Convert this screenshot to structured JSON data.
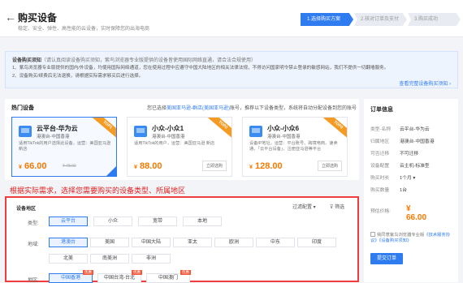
{
  "header": {
    "back_icon": "arrow-left-icon",
    "title": "购买设备",
    "subtitle": "稳定、安全、弹性、高性能的云设备，实时保障您的出海电商",
    "steps": [
      "1.选择购买方案",
      "2.核对订单及支付",
      "3.购买成功"
    ]
  },
  "notice": {
    "title": "设备购买须知",
    "title_note": "（请认真阅读设备购买须知，紫鸟浏览器专业版提供的设备皆使用国际网络直通，请合法合规使用）",
    "line1": "1、紫鸟浏览器专业版提供的国内/外设备，均使用国际网络通道，您在使用过程中应遵守中国大陆地区的相关法律法规，不得访问国家明令禁止登录的敏感网站，我们不提供一切翻墙服务。",
    "line2": "2、设备购买/续费后无法退换，请根据实际需求够买后进行选择。",
    "link": "查看完整设备购买须知 ›"
  },
  "main": {
    "title": "热门设备",
    "hint_prefix": "您已选择",
    "hint_link": "美国亚马逊-群店(美国亚马逊)",
    "hint_suffix": "账号，推荐以下设备类型，系统将自动分配设备到您的账号",
    "cards": [
      {
        "name": "云平台-华为云",
        "loc": "港澳台-中国香港",
        "desc": "适用TikTok的用户选择此设备，运营：美国亚马逊 新店",
        "price_symbol": "¥",
        "price": "66.00",
        "orig": "¥ 78.00",
        "badge": "TOP1"
      },
      {
        "name": "小众-小众1",
        "loc": "港澳台-中国香港",
        "desc": "适用TikTok的用户，运营：美国亚马逊 新店",
        "price_symbol": "¥",
        "price": "88.00",
        "button": "立即选购",
        "badge": "TOP2"
      },
      {
        "name": "小众-小众6",
        "loc": "港澳台-中国香港",
        "desc": "设备IP地址，运营：平台账号、跨境电商、速卖通、「云平台设备」，注册亚马逊等平台",
        "price_symbol": "¥",
        "price": "128.00",
        "button": "立即选购",
        "badge": "TOP3"
      }
    ]
  },
  "annotation": "根据实际需求，选择您需要购买的设备类型、所属地区",
  "filter": {
    "title": "设备地区",
    "sort_label": "过滤配置 ▾",
    "filter_label": "筛选",
    "type_label": "类型:",
    "types": [
      "云平台",
      "小众",
      "宽带",
      "本地"
    ],
    "region_label": "地域:",
    "regions_row1": [
      "港澳台",
      "美国",
      "中国大陆",
      "亚太",
      "欧洲",
      "中东",
      "印度"
    ],
    "regions_row2": [
      "北美",
      "南美洲",
      "非洲"
    ],
    "zone_label": "地区:",
    "zones": [
      "中国香港",
      "中国台湾-台北",
      "中国澳门"
    ],
    "zone_tag": "优惠"
  },
  "side": {
    "title": "订单信息",
    "rows": [
      {
        "k": "类型-名称",
        "v": "云平台-华为云"
      },
      {
        "k": "归属地区",
        "v": "港澳台-中国香港"
      },
      {
        "k": "可否迁移",
        "v": "不可迁移"
      },
      {
        "k": "设备配置",
        "v": "云主机-标准型"
      },
      {
        "k": "购买时长",
        "v": "1个月 ▾"
      },
      {
        "k": "购买数量",
        "v": "1台"
      }
    ],
    "price_label": "预估价格:",
    "price": "¥ 66.00",
    "agree_text": "我同意紫鸟浏览器专业版",
    "agree_link": "《技术服务协议》《设备购买须知》",
    "submit": "提交订单"
  }
}
